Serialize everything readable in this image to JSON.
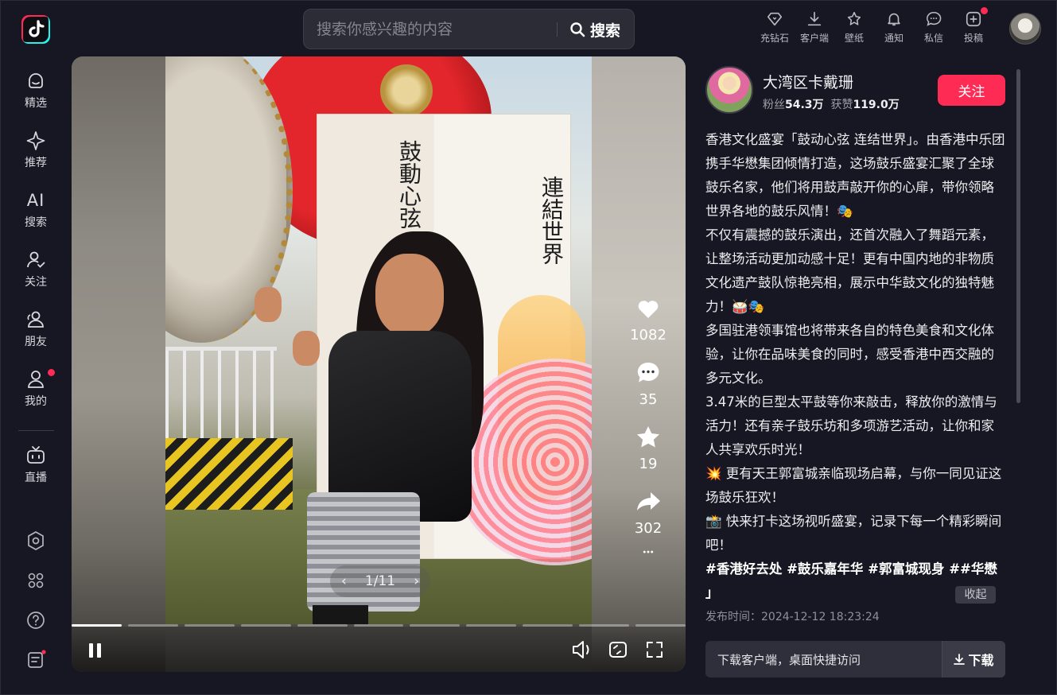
{
  "search": {
    "placeholder": "搜索你感兴趣的内容",
    "button": "搜索"
  },
  "top_actions": [
    {
      "label": "充钻石",
      "icon": "diamond-icon"
    },
    {
      "label": "客户端",
      "icon": "download-icon"
    },
    {
      "label": "壁纸",
      "icon": "wallpaper-icon"
    },
    {
      "label": "通知",
      "icon": "bell-icon"
    },
    {
      "label": "私信",
      "icon": "message-icon"
    },
    {
      "label": "投稿",
      "icon": "upload-icon"
    }
  ],
  "sidebar": {
    "items": [
      {
        "label": "精选",
        "icon": "featured-icon"
      },
      {
        "label": "推荐",
        "icon": "sparkle-icon"
      },
      {
        "label": "搜索",
        "icon": "ai-search-icon",
        "glyph": "AI"
      },
      {
        "label": "关注",
        "icon": "follow-icon"
      },
      {
        "label": "朋友",
        "icon": "friends-icon"
      },
      {
        "label": "我的",
        "icon": "profile-icon"
      },
      {
        "label": "直播",
        "icon": "live-tv-icon"
      }
    ]
  },
  "video": {
    "pager": "1/11",
    "likes": "1082",
    "comments": "35",
    "favorites": "19",
    "shares": "302",
    "box_text_main": "鼓動心弦",
    "box_text_sub": "連結世界",
    "progress_segments": 11,
    "progress_active": 1
  },
  "author": {
    "name": "大湾区卡戴珊",
    "fans_label": "粉丝",
    "fans": "54.3万",
    "likes_label": "获赞",
    "likes": "119.0万",
    "follow": "关注"
  },
  "description": {
    "paragraphs": [
      "香港文化盛宴「鼓动心弦 连结世界」。由香港中乐团携手华懋集团倾情打造，这场鼓乐盛宴汇聚了全球鼓乐名家，他们将用鼓声敲开你的心扉，带你领略世界各地的鼓乐风情！🎭",
      "不仅有震撼的鼓乐演出，还首次融入了舞蹈元素，让整场活动更加动感十足！更有中国内地的非物质文化遗产鼓队惊艳亮相，展示中华鼓文化的独特魅力！🥁🎭",
      "多国驻港领事馆也将带来各自的特色美食和文化体验，让你在品味美食的同时，感受香港中西交融的多元文化。",
      "3.47米的巨型太平鼓等你来敲击，释放你的激情与活力！还有亲子鼓乐坊和多项游艺活动，让你和家人共享欢乐时光！",
      "💥 更有天王郭富城亲临现场启幕，与你一同见证这场鼓乐狂欢！",
      "📸 快来打卡这场视听盛宴，记录下每一个精彩瞬间吧！"
    ],
    "tags": "#香港好去处  #鼓乐嘉年华  #郭富城现身  ##华懋 」",
    "collapse": "收起",
    "publish_time": "发布时间：2024-12-12 18:23:24"
  },
  "download_bar": {
    "text": "下载客户端，桌面快捷访问",
    "button": "下载"
  },
  "colors": {
    "accent": "#fe2c55",
    "background": "#161722",
    "panel": "#2e2f3a"
  }
}
